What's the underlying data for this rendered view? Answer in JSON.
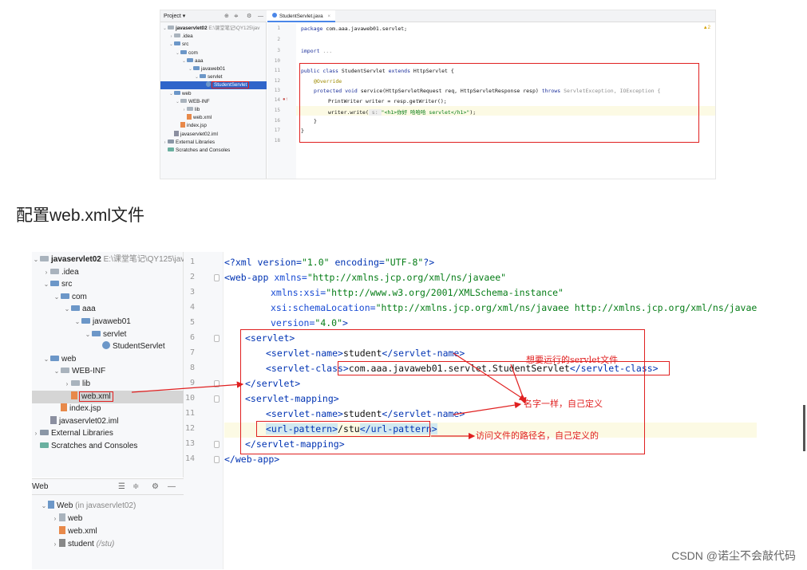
{
  "top_screenshot": {
    "project_tool": {
      "title": "Project ▾",
      "icons": [
        "target-icon",
        "collapse-icon",
        "gear-icon",
        "minimize-icon"
      ]
    },
    "tree": [
      {
        "label": "javaservlet02",
        "suffix": "E:\\课堂笔记\\QY125\\jav",
        "depth": 0,
        "arrow": "⌄",
        "bold": true
      },
      {
        "label": ".idea",
        "depth": 1,
        "arrow": "›"
      },
      {
        "label": "src",
        "depth": 1,
        "arrow": "⌄"
      },
      {
        "label": "com",
        "depth": 2,
        "arrow": "⌄"
      },
      {
        "label": "aaa",
        "depth": 3,
        "arrow": "⌄"
      },
      {
        "label": "javaweb01",
        "depth": 4,
        "arrow": "⌄"
      },
      {
        "label": "servlet",
        "depth": 5,
        "arrow": "⌄"
      },
      {
        "label": "StudentServlet",
        "depth": 6,
        "arrow": "",
        "selected": true
      },
      {
        "label": "web",
        "depth": 1,
        "arrow": "⌄"
      },
      {
        "label": "WEB-INF",
        "depth": 2,
        "arrow": "⌄"
      },
      {
        "label": "lib",
        "depth": 3,
        "arrow": "›"
      },
      {
        "label": "web.xml",
        "depth": 3,
        "arrow": ""
      },
      {
        "label": "index.jsp",
        "depth": 2,
        "arrow": ""
      },
      {
        "label": "javaservlet02.iml",
        "depth": 1,
        "arrow": ""
      },
      {
        "label": "External Libraries",
        "depth": 0,
        "arrow": "›"
      },
      {
        "label": "Scratches and Consoles",
        "depth": 0,
        "arrow": ""
      }
    ],
    "tab": "StudentServlet.java",
    "tab_close": "×",
    "warning": "▲2",
    "line_numbers": [
      "1",
      "2",
      "3",
      "10",
      "11",
      "12",
      "13",
      "14",
      "15",
      "16",
      "17",
      "18"
    ],
    "code": {
      "package_kw": "package",
      "package_name": " com.aaa.javaweb01.servlet;",
      "import_kw": "import",
      "import_rest": " ...",
      "class_line_kw1": "public class",
      "class_line_name": " StudentServlet ",
      "class_line_kw2": "extends",
      "class_line_rest": " HttpServlet {",
      "override": "@Override",
      "method_kw": "protected void",
      "method_rest": " service(HttpServletRequest req, HttpServletResponse resp) ",
      "throws_kw": "throws",
      "throws_rest": " ServletException, IOException {",
      "writer_line": "PrintWriter writer = resp.getWriter();",
      "write_prefix": "writer.write(",
      "write_hint": " s: ",
      "write_string": "\"<h1>你好 哈哈哈 servlet</h1>\"",
      "write_suffix": ");",
      "close1": "}",
      "close2": "}"
    }
  },
  "caption": "配置web.xml文件",
  "bottom_screenshot": {
    "tree": [
      {
        "label": "javaservlet02",
        "suffix": "E:\\课堂笔记\\QY125\\jav",
        "depth": 0,
        "arrow": "⌄",
        "bold": true
      },
      {
        "label": ".idea",
        "depth": 1,
        "arrow": "›"
      },
      {
        "label": "src",
        "depth": 1,
        "arrow": "⌄"
      },
      {
        "label": "com",
        "depth": 2,
        "arrow": "⌄"
      },
      {
        "label": "aaa",
        "depth": 3,
        "arrow": "⌄"
      },
      {
        "label": "javaweb01",
        "depth": 4,
        "arrow": "⌄"
      },
      {
        "label": "servlet",
        "depth": 5,
        "arrow": "⌄"
      },
      {
        "label": "StudentServlet",
        "depth": 6,
        "arrow": ""
      },
      {
        "label": "web",
        "depth": 1,
        "arrow": "⌄"
      },
      {
        "label": "WEB-INF",
        "depth": 2,
        "arrow": "⌄"
      },
      {
        "label": "lib",
        "depth": 3,
        "arrow": "›"
      },
      {
        "label": "web.xml",
        "depth": 3,
        "arrow": "",
        "selected": true
      },
      {
        "label": "index.jsp",
        "depth": 2,
        "arrow": ""
      },
      {
        "label": "javaservlet02.iml",
        "depth": 1,
        "arrow": ""
      },
      {
        "label": "External Libraries",
        "depth": 0,
        "arrow": "›"
      },
      {
        "label": "Scratches and Consoles",
        "depth": 0,
        "arrow": ""
      }
    ],
    "web_panel": {
      "title": "Web",
      "icons": [
        "align-icon",
        "collapse-icon",
        "gear-icon",
        "minimize-icon"
      ],
      "items": [
        {
          "label": "Web",
          "suffix": " (in javaservlet02)",
          "depth": 0,
          "arrow": "⌄"
        },
        {
          "label": "web",
          "suffix": "",
          "depth": 1,
          "arrow": "›"
        },
        {
          "label": "web.xml",
          "suffix": "",
          "depth": 1,
          "arrow": ""
        },
        {
          "label": "student",
          "suffix": " (/stu)",
          "depth": 1,
          "arrow": "›"
        }
      ]
    },
    "line_numbers": [
      "1",
      "2",
      "3",
      "4",
      "5",
      "6",
      "7",
      "8",
      "9",
      "10",
      "11",
      "12",
      "13",
      "14"
    ],
    "code": {
      "l1_a": "<?",
      "l1_b": "xml version=",
      "l1_c": "\"1.0\"",
      "l1_d": " encoding=",
      "l1_e": "\"UTF-8\"",
      "l1_f": "?>",
      "l2_a": "<web-app ",
      "l2_b": "xmlns=",
      "l2_c": "\"http://xmlns.jcp.org/xml/ns/javaee\"",
      "l3_b": "xmlns:xsi=",
      "l3_c": "\"http://www.w3.org/2001/XMLSchema-instance\"",
      "l4_b": "xsi:schemaLocation=",
      "l4_c": "\"http://xmlns.jcp.org/xml/ns/javaee http://xmlns.jcp.org/xml/ns/javaee/we",
      "l5_b": "version=",
      "l5_c": "\"4.0\"",
      "l5_d": ">",
      "l6": "<servlet>",
      "l7_a": "<servlet-name>",
      "l7_b": "student",
      "l7_c": "</servlet-name>",
      "l8_a": "<servlet-class>",
      "l8_b": "com.aaa.javaweb01.servlet.StudentServlet",
      "l8_c": "</servlet-class>",
      "l9": "</servlet>",
      "l10": "<servlet-mapping>",
      "l11_a": "<servlet-name>",
      "l11_b": "student",
      "l11_c": "</servlet-name>",
      "l12_a": "<url-pattern>",
      "l12_b": "/stu",
      "l12_c": "</url-pattern>",
      "l13": "</servlet-mapping>",
      "l14": "</web-app>"
    },
    "notes": {
      "servlet_file": "想要运行的servlet文件",
      "same_name": "名字一样，自己定义",
      "access_path": "访问文件的路径名，自己定义的"
    }
  },
  "watermark": "CSDN @诺尘不会敲代码",
  "colors": {
    "annotation_red": "#e02020",
    "selection_blue": "#2f65ca",
    "xml_tag": "#0033b3",
    "xml_value": "#067d17"
  }
}
